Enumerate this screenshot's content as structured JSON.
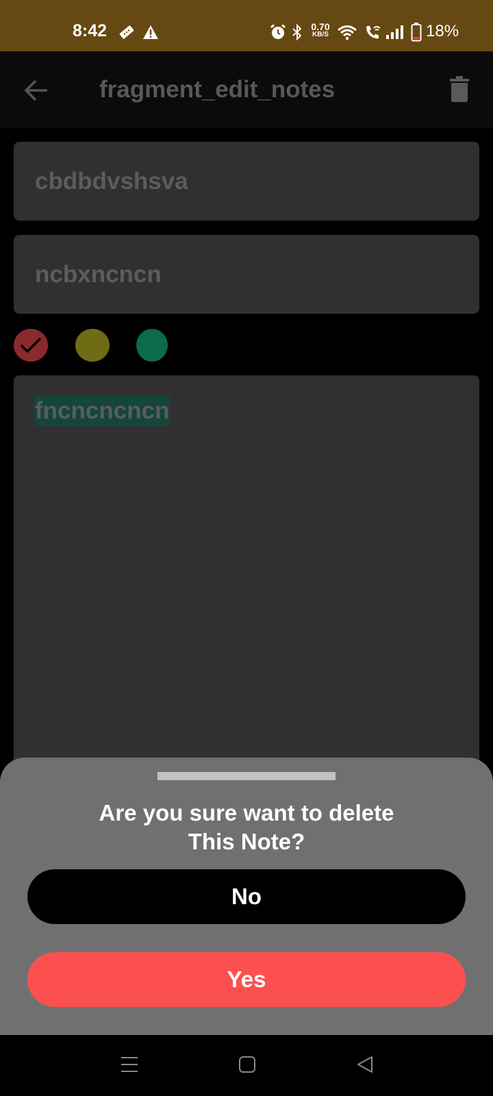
{
  "status_bar": {
    "time": "8:42",
    "net_speed_value": "0.70",
    "net_speed_unit": "KB/S",
    "battery": "18%",
    "icons": [
      "ticket-icon",
      "warning-icon",
      "alarm-icon",
      "bluetooth-icon",
      "wifi-icon",
      "wifi-call-icon",
      "signal-icon",
      "battery-icon"
    ]
  },
  "app_bar": {
    "title": "fragment_edit_notes",
    "back_icon": "back-arrow-icon",
    "delete_icon": "trash-icon"
  },
  "note": {
    "title_value": "cbdbdvshsva",
    "subtitle_value": "ncbxncncn",
    "body_value": "fncncncncn",
    "priority_colors": [
      "#8a2a2f",
      "#6f6c16",
      "#0b6b4a"
    ],
    "selected_priority_index": 0
  },
  "dialog": {
    "question": "Are you sure want to delete\nThis Note?",
    "no_label": "No",
    "yes_label": "Yes",
    "no_color": "#000000",
    "yes_color": "#fc5050"
  },
  "nav_bar": {
    "icons": [
      "menu-icon",
      "home-icon",
      "back-icon"
    ]
  },
  "colors": {
    "status_bar": "#664812",
    "app_bar": "#0b0b0b",
    "field": "#303030",
    "sheet": "#707070"
  }
}
